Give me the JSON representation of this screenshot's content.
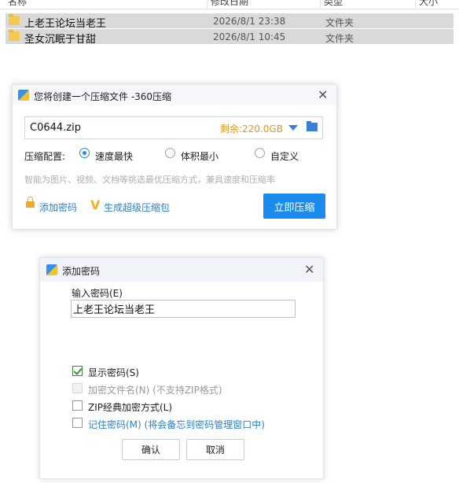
{
  "file_list": {
    "columns": [
      "名称",
      "修改日期",
      "类型",
      "大小"
    ],
    "rows": [
      {
        "name": "上老王论坛当老王",
        "date": "2026/8/1 23:38",
        "type": "文件夹"
      },
      {
        "name": "圣女沉眠于甘甜",
        "date": "2026/8/1 10:45",
        "type": "文件夹"
      }
    ]
  },
  "compress_dialog": {
    "title": "您将创建一个压缩文件 -360压缩",
    "filename": "C0644.zip",
    "free_space": "剩余:220.0GB",
    "config_label": "压缩配置:",
    "options": [
      "速度最快",
      "体积最小",
      "自定义"
    ],
    "selected_option": "速度最快",
    "hint": "智能为图片、视频、文档等挑选最优压缩方式，兼具速度和压缩率",
    "add_password_link": "添加密码",
    "super_compress_link": "生成超级压缩包",
    "compress_button": "立即压缩"
  },
  "password_dialog": {
    "title": "添加密码",
    "input_label": "输入密码(E)",
    "password_value": "上老王论坛当老王",
    "checkboxes": [
      {
        "label": "显示密码(S)",
        "checked": true,
        "disabled": false
      },
      {
        "label": "加密文件名(N) (不支持ZIP格式)",
        "checked": false,
        "disabled": true
      },
      {
        "label": "ZIP经典加密方式(L)",
        "checked": false,
        "disabled": false
      },
      {
        "label": "记住密码(M) (将会备忘到密码管理窗口中)",
        "checked": false,
        "disabled": false
      }
    ],
    "ok_button": "确认",
    "cancel_button": "取消"
  },
  "colors": {
    "accent": "#1a8cf0",
    "link": "#2b7fd8",
    "free_space": "#e6961e",
    "selected_row": "#d9d9d9"
  }
}
